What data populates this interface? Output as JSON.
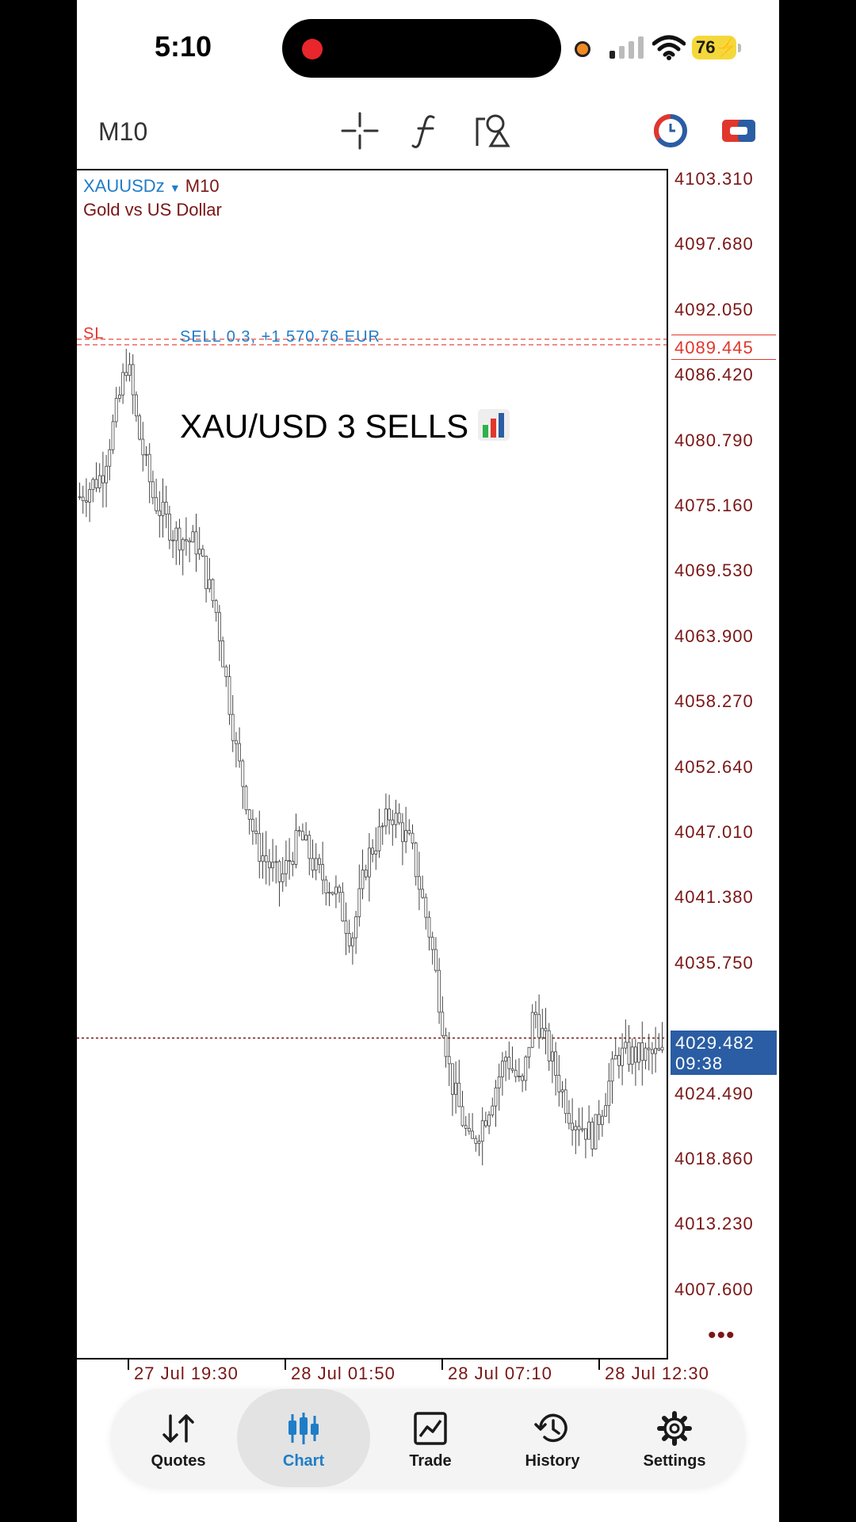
{
  "status_bar": {
    "time": "5:10",
    "battery": "76"
  },
  "toolbar": {
    "timeframe": "M10"
  },
  "chart": {
    "symbol": "XAUUSDz",
    "symbol_timeframe": "M10",
    "description": "Gold vs US Dollar",
    "sl_label": "SL",
    "trade_label": "SELL 0.3, +1 570.76 EUR",
    "overlay_title": "XAU/USD 3 SELLS",
    "price_labels": [
      "4103.310",
      "4097.680",
      "4092.050",
      "4086.420",
      "4080.790",
      "4075.160",
      "4069.530",
      "4063.900",
      "4058.270",
      "4052.640",
      "4047.010",
      "4041.380",
      "4035.750",
      "4024.490",
      "4018.860",
      "4013.230",
      "4007.600"
    ],
    "sell_price": "4089.445",
    "current_price": "4029.482",
    "countdown": "09:38",
    "more": "•••",
    "time_labels": [
      "27 Jul 19:30",
      "28 Jul 01:50",
      "28 Jul 07:10",
      "28 Jul 12:30"
    ],
    "colors": {
      "sell_line": "#e2362c",
      "price_text": "#7a1616",
      "current_price_bg": "#2a5da3",
      "symbol": "#1f7dc8"
    }
  },
  "tabs": [
    {
      "label": "Quotes",
      "icon": "arrows-up-down-icon"
    },
    {
      "label": "Chart",
      "icon": "candlestick-icon",
      "active": true
    },
    {
      "label": "Trade",
      "icon": "line-chart-icon"
    },
    {
      "label": "History",
      "icon": "clock-history-icon"
    },
    {
      "label": "Settings",
      "icon": "gear-icon"
    }
  ]
}
